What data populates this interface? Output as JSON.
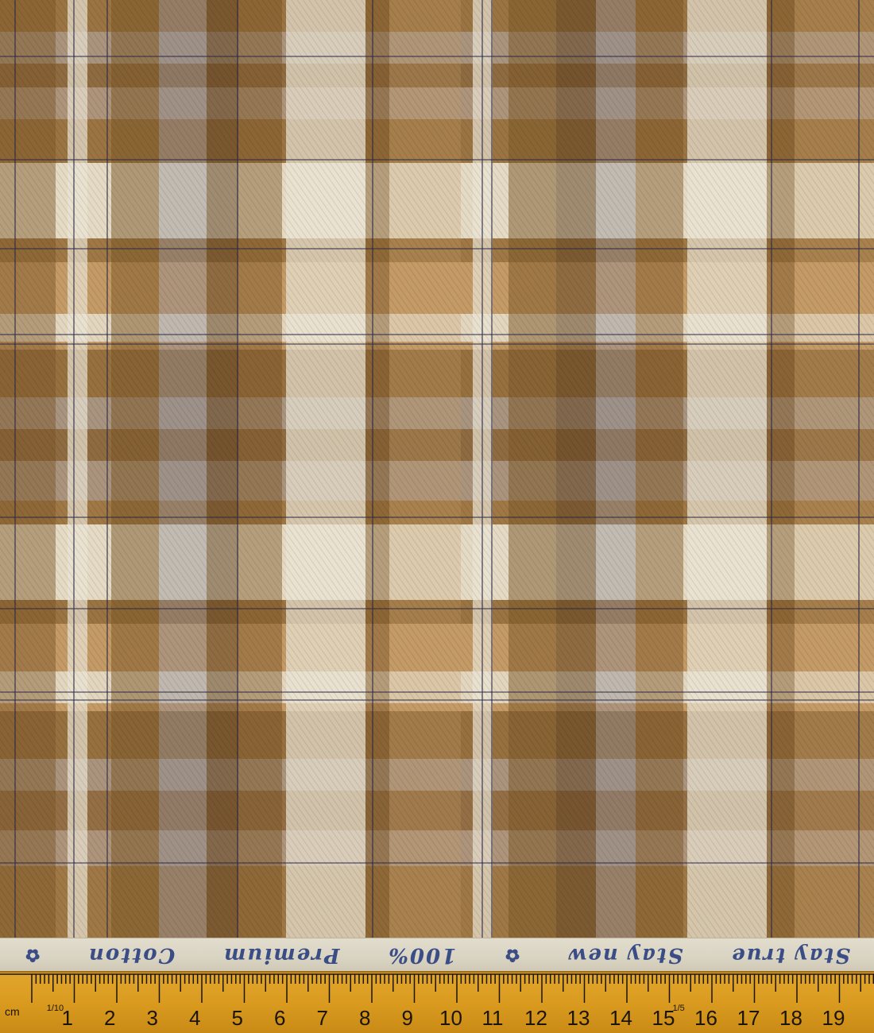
{
  "image": {
    "subject": "Brown, beige and slate-blue plaid fabric swatch with woven selvedge text and a measuring ruler along the bottom edge",
    "colors": {
      "camel": "#c49a66",
      "brown": "#7a5526",
      "dark_brown": "#5a3c1c",
      "cream": "#ebe5d5",
      "slate_blue": "#8b8d98",
      "navy": "#2e2a46",
      "ruler_yellow": "#d99a1f",
      "selvedge_blue": "#3b4d86"
    }
  },
  "selvedge": {
    "items": [
      "Stay true",
      "Stay new",
      "✿",
      "100%",
      "Premium",
      "Cotton",
      "✿"
    ]
  },
  "ruler": {
    "unit_label": "cm",
    "tenth_label": "1/10",
    "fifth_label": "1/5",
    "numbers": [
      "1",
      "2",
      "3",
      "4",
      "5",
      "6",
      "7",
      "8",
      "9",
      "10",
      "11",
      "12",
      "13",
      "14",
      "15",
      "16",
      "17",
      "18",
      "19"
    ]
  }
}
